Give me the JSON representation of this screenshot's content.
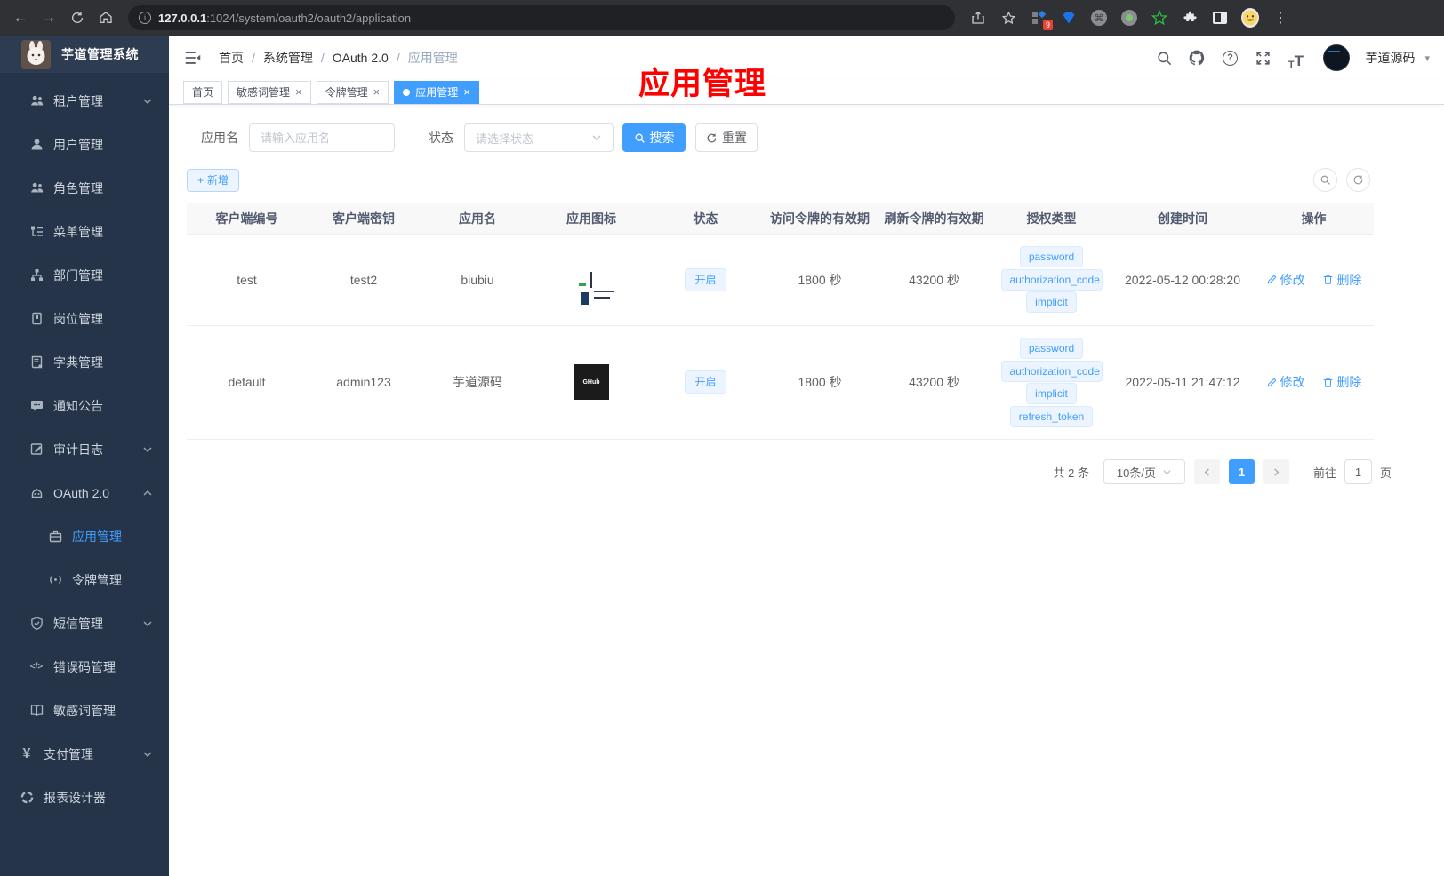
{
  "browser": {
    "url_host": "127.0.0.1",
    "url_path": ":1024/system/oauth2/oauth2/application",
    "extension_badge": "9"
  },
  "icons": {
    "close": "×",
    "plus": "+",
    "question": "?",
    "info": "i",
    "text_small": "T",
    "text_big": "T",
    "code": "</>",
    "yen": "¥",
    "kebab": "⋮",
    "caret": "▾",
    "back": "←",
    "forward": "→",
    "command": "⌘"
  },
  "sidebar": {
    "title": "芋道管理系统",
    "items": [
      {
        "label": "租户管理"
      },
      {
        "label": "用户管理"
      },
      {
        "label": "角色管理"
      },
      {
        "label": "菜单管理"
      },
      {
        "label": "部门管理"
      },
      {
        "label": "岗位管理"
      },
      {
        "label": "字典管理"
      },
      {
        "label": "通知公告"
      },
      {
        "label": "审计日志"
      },
      {
        "label": "OAuth 2.0"
      },
      {
        "label": "应用管理"
      },
      {
        "label": "令牌管理"
      },
      {
        "label": "短信管理"
      },
      {
        "label": "错误码管理"
      },
      {
        "label": "敏感词管理"
      },
      {
        "label": "支付管理"
      },
      {
        "label": "报表设计器"
      }
    ]
  },
  "navbar": {
    "breadcrumb": [
      "首页",
      "系统管理",
      "OAuth 2.0",
      "应用管理"
    ],
    "separator": "/",
    "username": "芋道源码"
  },
  "tabs": [
    {
      "label": "首页"
    },
    {
      "label": "敏感词管理"
    },
    {
      "label": "令牌管理"
    },
    {
      "label": "应用管理"
    }
  ],
  "annotation": {
    "text": "应用管理"
  },
  "filter": {
    "app_name_label": "应用名",
    "app_name_placeholder": "请输入应用名",
    "status_label": "状态",
    "status_placeholder": "请选择状态",
    "search_label": "搜索",
    "reset_label": "重置"
  },
  "toolbar": {
    "add_label": "新增"
  },
  "table": {
    "columns": [
      "客户端编号",
      "客户端密钥",
      "应用名",
      "应用图标",
      "状态",
      "访问令牌的有效期",
      "刷新令牌的有效期",
      "授权类型",
      "创建时间",
      "操作"
    ],
    "rows": [
      {
        "client_id": "test",
        "client_secret": "test2",
        "app_name": "biubiu",
        "status": "开启",
        "access_token_ttl": "1800 秒",
        "refresh_token_ttl": "43200 秒",
        "grant_types": [
          "password",
          "authorization_code",
          "implicit"
        ],
        "created_at": "2022-05-12 00:28:20",
        "edit_label": "修改",
        "delete_label": "删除"
      },
      {
        "client_id": "default",
        "client_secret": "admin123",
        "app_name": "芋道源码",
        "icon_label": "GHub",
        "status": "开启",
        "access_token_ttl": "1800 秒",
        "refresh_token_ttl": "43200 秒",
        "grant_types": [
          "password",
          "authorization_code",
          "implicit",
          "refresh_token"
        ],
        "created_at": "2022-05-11 21:47:12",
        "edit_label": "修改",
        "delete_label": "删除"
      }
    ]
  },
  "pagination": {
    "total": "共 2 条",
    "page_size": "10条/页",
    "current_page": "1",
    "goto_label": "前往",
    "goto_value": "1",
    "page_unit": "页"
  },
  "colors": {
    "accent": "#409EFF",
    "tag_bg": "#ecf5ff",
    "tag_border": "#d9ecff",
    "sidebar_bg": "#26344a",
    "annotation_red": "#ff0000",
    "browser_bar": "#303134"
  }
}
